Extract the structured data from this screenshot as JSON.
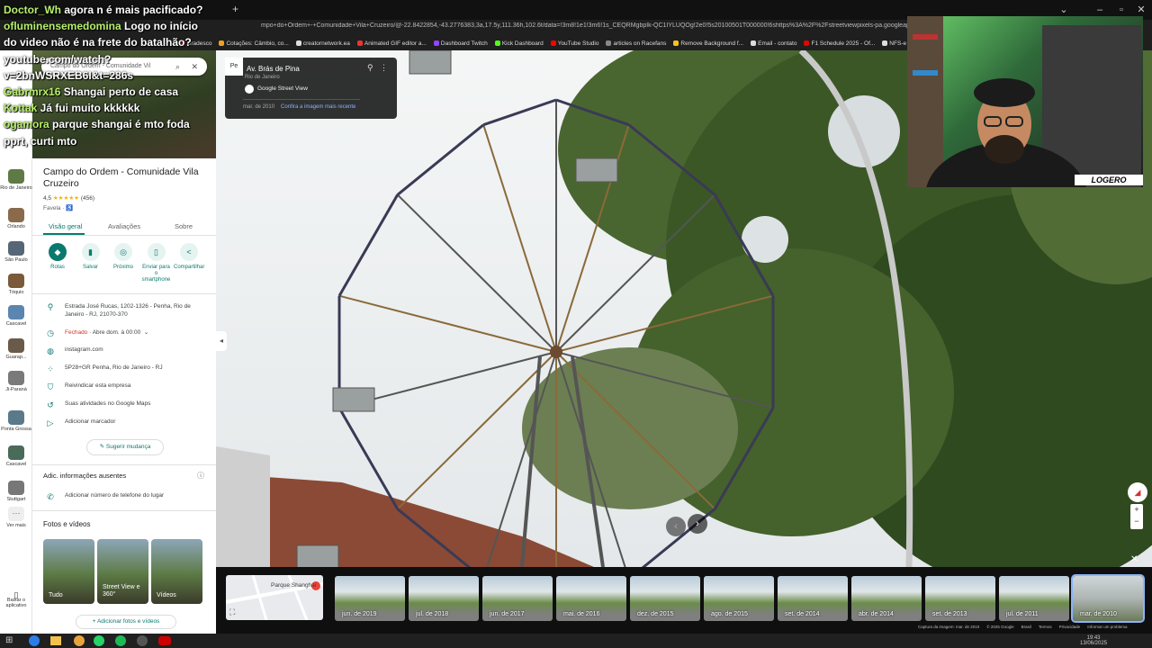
{
  "browser": {
    "url": "mpo+do+Ordem+-+Comunidade+Vila+Cruzeiro/@-22.8422854,-43.2776383,3a,17.5y,111.36h,102.6t/data=!3m8!1e1!3m6!1s_CEQRMgbpIk-QC1IYLUQOg!2e0!5s20100501T000000!6shttps%3A%2F%2Fstreetviewpixels-pa.googleapis.com%2Fv1%2Fthumbnail%3",
    "new_tab": "+",
    "bookmarks": [
      "Bradesco",
      "Cotações: Câmbio, co...",
      "creatornetwork.ea",
      "Animated GIF editor a...",
      "Dashboard Twitch",
      "Kick Dashboard",
      "YouTube Studio",
      "articles on Racefans",
      "Remove Background f...",
      "Email - contato",
      "F1 Schedule 2025 - Of...",
      "NFS-e | Portal Contr"
    ],
    "bookmark_colors": [
      "#c8102e",
      "#f0a020",
      "#ddd",
      "#e33",
      "#9146ff",
      "#53fc18",
      "#f00",
      "#888",
      "#f5c518",
      "#ddd",
      "#e10600",
      "#ddd"
    ]
  },
  "chat": [
    {
      "name": "Doctor_Wh",
      "msg": "agora n é mais pacificado?"
    },
    {
      "name": "ofluminensemedomina",
      "msg": "Logo no início"
    },
    {
      "name": "",
      "msg": "do video não é na frete do batalhão?"
    },
    {
      "name": "",
      "msg": "youtube.com/watch?"
    },
    {
      "name": "",
      "msg": "v=2bnWSRXEB6I&t=286s"
    },
    {
      "name": "Gabrmrx16",
      "msg": "Shangai perto de casa"
    },
    {
      "name": "Kottak",
      "msg": "Já fui muito kkkkkk"
    },
    {
      "name": "ogamora",
      "msg": "parque shangai é mto foda"
    },
    {
      "name": "",
      "msg": "pprt, curti mto"
    }
  ],
  "rail": {
    "items": [
      "Rio de Janeiro",
      "Orlando",
      "São Paulo",
      "Tóquio",
      "Cascavel",
      "Guarap...",
      "Ji-Paraná",
      "Ponta Grossa",
      "Cascavel",
      "Stuttgart",
      "Ver mais"
    ],
    "download": "Baixar o aplicativo"
  },
  "search": {
    "value": "Campo do Ordem - Comunidade Vil"
  },
  "place": {
    "title": "Campo do Ordem - Comunidade Vila Cruzeiro",
    "rating": "4,5",
    "stars": "★★★★★",
    "reviews": "(456)",
    "category": "Favela · ♿"
  },
  "tabs": [
    "Visão geral",
    "Avaliações",
    "Sobre"
  ],
  "actions": [
    {
      "label": "Rotas",
      "icon": "◆"
    },
    {
      "label": "Salvar",
      "icon": "▮"
    },
    {
      "label": "Próximo",
      "icon": "◎"
    },
    {
      "label": "Enviar para o smartphone",
      "icon": "▯"
    },
    {
      "label": "Compartilhar",
      "icon": "<"
    }
  ],
  "info": {
    "address": "Estrada José Rucas, 1202-1326 - Penha, Rio de Janeiro - RJ, 21070-370",
    "hours_status": "Fechado",
    "hours_next": " · Abre dom. à 00:00",
    "website": "instagram.com",
    "plus_code": "5P28+GR Penha, Rio de Janeiro - RJ",
    "claim": "Reivindicar esta empresa",
    "activity": "Suas atividades no Google Maps",
    "label": "Adicionar marcador",
    "suggest": "Sugerir mudança",
    "missing_title": "Adic. informações ausentes",
    "add_phone": "Adicionar número de telefone do lugar"
  },
  "photos": {
    "title": "Fotos e vídeos",
    "items": [
      "Tudo",
      "Street View e 360°",
      "Vídeos"
    ],
    "add": "Adicionar fotos e vídeos"
  },
  "sv_card": {
    "street": "Av. Brás de Pina",
    "city": "Rio de Janeiro",
    "source": "Google Street View",
    "date": "mar. de 2010",
    "latest": "Confira a imagem mais recente"
  },
  "webcam": {
    "brand": "LOGERO"
  },
  "minimap": {
    "label": "Parque Shanghai"
  },
  "timeline": [
    "jun. de 2019",
    "jul. de 2018",
    "jun. de 2017",
    "mai. de 2016",
    "dez. de 2015",
    "ago. de 2015",
    "set. de 2014",
    "abr. de 2014",
    "set. de 2013",
    "jul. de 2011",
    "mar. de 2010"
  ],
  "footer": [
    "Captura da imagem: mar. de 2010",
    "© 2025 Google",
    "Brasil",
    "Termos",
    "Privacidade",
    "Informar um problema"
  ],
  "taskbar": {
    "time": "19:43",
    "date": "13/06/2025"
  },
  "colors": {
    "accent": "#0b7a6e",
    "closed": "#d93025",
    "chat_name": "#b7f06a"
  }
}
